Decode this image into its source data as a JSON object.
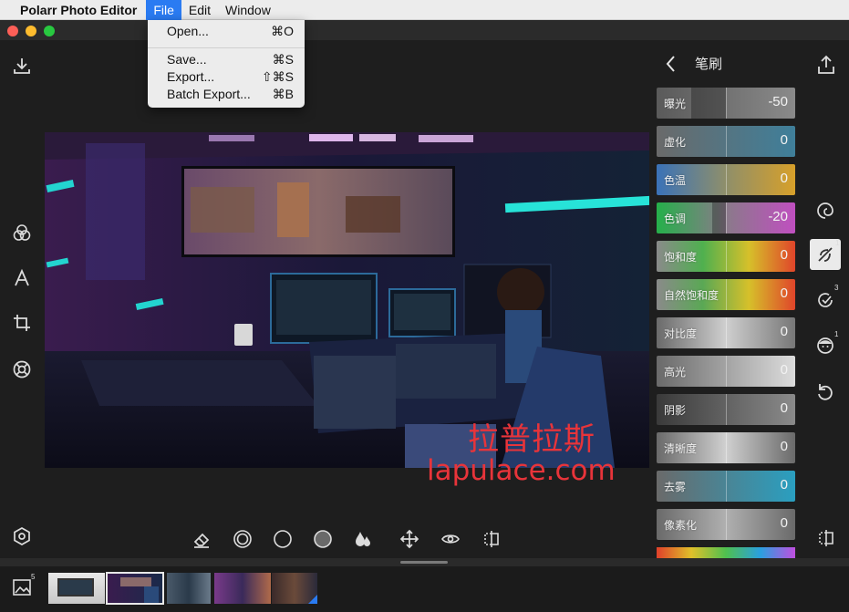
{
  "menubar": {
    "app_name": "Polarr Photo Editor",
    "menus": [
      "File",
      "Edit",
      "Window"
    ]
  },
  "file_menu": {
    "items": [
      {
        "label": "Open...",
        "shortcut": "⌘O"
      },
      {
        "label": "Save...",
        "shortcut": "⌘S"
      },
      {
        "label": "Export...",
        "shortcut": "⇧⌘S"
      },
      {
        "label": "Batch Export...",
        "shortcut": "⌘B"
      }
    ]
  },
  "panel": {
    "title": "笔刷",
    "sliders": [
      {
        "label": "曝光",
        "value": "-50",
        "amount": -0.5,
        "gradient": "linear-gradient(90deg,#5a5a5a,#8a8a8a)"
      },
      {
        "label": "虚化",
        "value": "0",
        "amount": 0,
        "gradient": "linear-gradient(90deg,#6a6a6a,#3f7f9a)"
      },
      {
        "label": "色温",
        "value": "0",
        "amount": 0,
        "gradient": "linear-gradient(90deg,#3a72b8,#8f8f6a,#d7a02a)"
      },
      {
        "label": "色调",
        "value": "-20",
        "amount": -0.2,
        "gradient": "linear-gradient(90deg,#25b04a,#8a7a8a,#c04fc0)"
      },
      {
        "label": "饱和度",
        "value": "0",
        "amount": 0,
        "gradient": "linear-gradient(90deg,#8a8a8a,#4fb04f,#d6c02a,#e0452a)"
      },
      {
        "label": "自然饱和度",
        "value": "0",
        "amount": 0,
        "gradient": "linear-gradient(90deg,#8a8a8a,#5aa855,#d6c02a,#e0452a)"
      },
      {
        "label": "对比度",
        "value": "0",
        "amount": 0,
        "gradient": "linear-gradient(90deg,#6a6a6a,#cfcfcf,#777)"
      },
      {
        "label": "高光",
        "value": "0",
        "amount": 0,
        "gradient": "linear-gradient(90deg,#6a6a6a,#dcdcdc)"
      },
      {
        "label": "阴影",
        "value": "0",
        "amount": 0,
        "gradient": "linear-gradient(90deg,#3a3a3a,#8a8a8a)"
      },
      {
        "label": "清晰度",
        "value": "0",
        "amount": 0,
        "gradient": "linear-gradient(90deg,#6a6a6a,#d0d0d0,#6a6a6a)"
      },
      {
        "label": "去雾",
        "value": "0",
        "amount": 0,
        "gradient": "linear-gradient(90deg,#6a6a6a,#2a9fc0)"
      },
      {
        "label": "像素化",
        "value": "0",
        "amount": 0,
        "gradient": "linear-gradient(90deg,#6a6a6a,#b0b0b0,#6a6a6a)"
      }
    ]
  },
  "right_tools": [
    {
      "name": "spiral-icon",
      "badge": ""
    },
    {
      "name": "brush-erase-icon",
      "badge": "1"
    },
    {
      "name": "healing-icon",
      "badge": "3"
    },
    {
      "name": "face-icon",
      "badge": "1"
    },
    {
      "name": "undo-icon",
      "badge": ""
    }
  ],
  "left_tools": [
    "download-icon",
    "filters-icon",
    "text-icon",
    "crop-icon",
    "lifebuoy-icon",
    "hexagon-settings-icon"
  ],
  "bottom_tools": [
    "eraser-icon",
    "radial-target-icon",
    "circle-outline-icon",
    "circle-filled-icon",
    "drops-icon",
    "move-icon",
    "eye-icon",
    "compare-icon"
  ],
  "watermark": {
    "line1": "拉普拉斯",
    "line2": "lapulace.com"
  },
  "filmstrip": {
    "library_count": "5"
  },
  "colors": {
    "accent": "#2a7bf2",
    "watermark": "#e8343a"
  }
}
